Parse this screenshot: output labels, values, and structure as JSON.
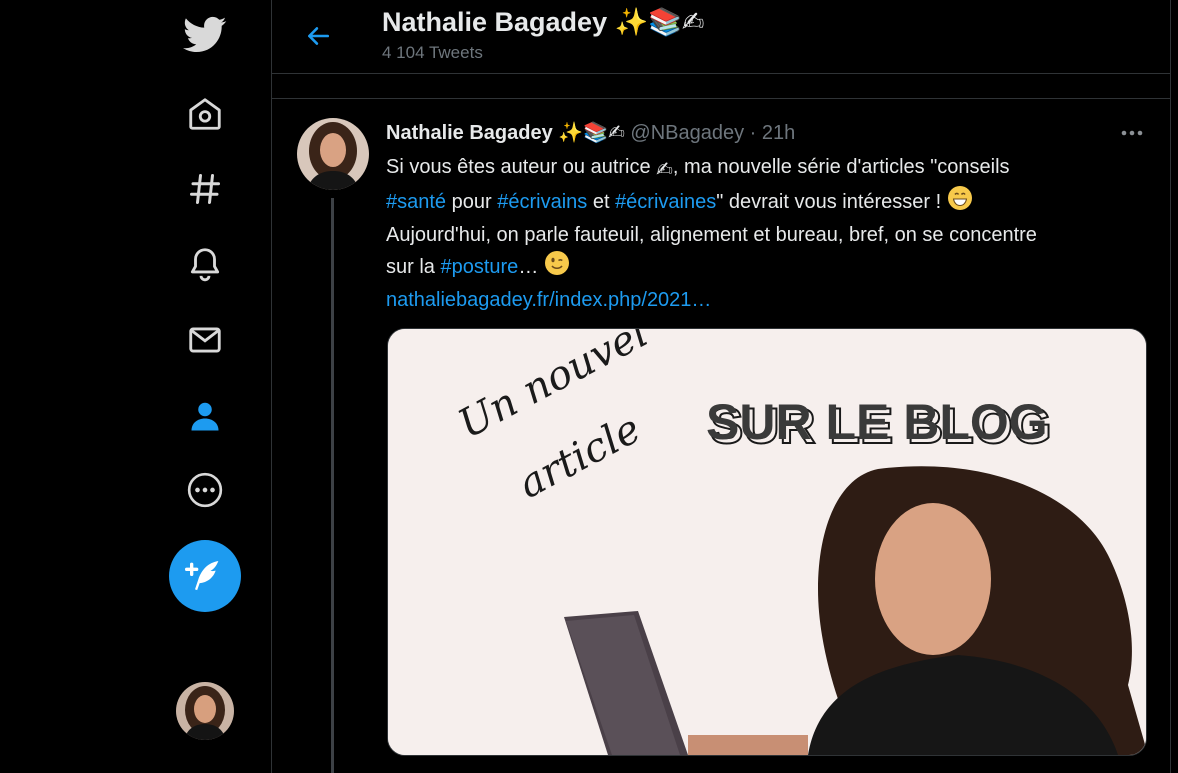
{
  "header": {
    "title": "Nathalie Bagadey",
    "title_emoji": "✨📚✍",
    "subtitle": "4 104 Tweets"
  },
  "tweet": {
    "name": "Nathalie Bagadey",
    "name_emoji": "✨📚✍",
    "handle": "@NBagadey",
    "sep": " · ",
    "time": "21h",
    "line1a": "Si vous êtes auteur ou autrice ",
    "line1b": ", ma nouvelle série d'articles \"conseils",
    "tag1": "#santé",
    "w_pour": " pour ",
    "tag2": "#écrivains",
    "w_et": " et ",
    "tag3": "#écrivaines",
    "w_tail": "\" devrait vous intéresser ! ",
    "line3": "Aujourd'hui, on parle fauteuil, alignement et bureau, bref, on se concentre",
    "w_sur": "sur la ",
    "tag4": "#posture",
    "ellip": "…  ",
    "link": "nathaliebagadey.fr/index.php/2021…"
  },
  "media": {
    "script_text_1": "Un nouvel",
    "script_text_2": "article",
    "headline": "SUR LE BLOG"
  },
  "colors": {
    "accent": "#1d9bf0",
    "background": "#000000",
    "border": "#2f3336",
    "muted": "#6e767d"
  },
  "icons": [
    "twitter-bird",
    "home",
    "explore-hash",
    "notifications-bell",
    "messages-envelope",
    "profile",
    "more-circle",
    "compose-feather"
  ]
}
